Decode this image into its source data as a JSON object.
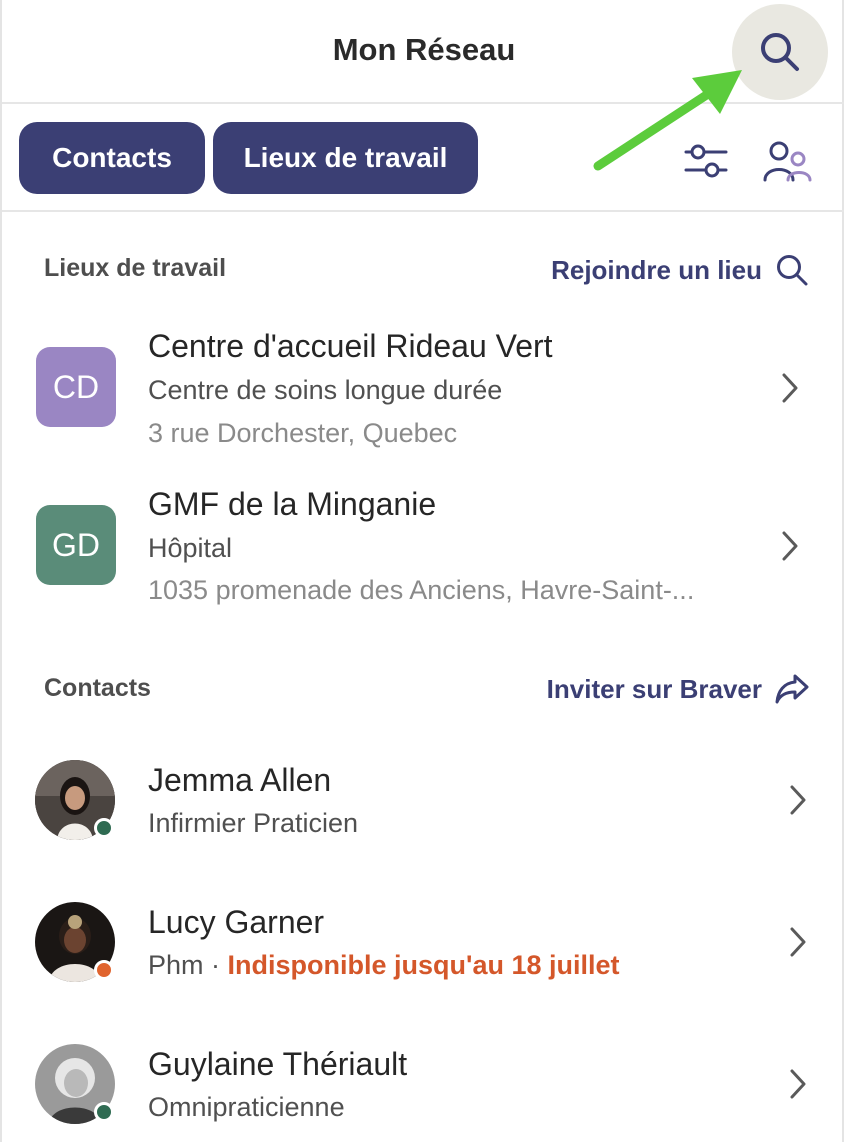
{
  "header": {
    "title": "Mon Réseau",
    "search_icon": "search-icon"
  },
  "tabs": [
    {
      "label": "Contacts"
    },
    {
      "label": "Lieux de travail"
    }
  ],
  "toolbar_icons": {
    "filter": "sliders-icon",
    "people": "people-icon"
  },
  "workplaces": {
    "title": "Lieux de travail",
    "action_label": "Rejoindre un lieu",
    "items": [
      {
        "initials": "CD",
        "color": "#9a86c3",
        "name": "Centre d'accueil Rideau Vert",
        "type": "Centre de soins longue durée",
        "address": "3 rue Dorchester, Quebec"
      },
      {
        "initials": "GD",
        "color": "#5a8c79",
        "name": "GMF de la Minganie",
        "type": "Hôpital",
        "address": "1035 promenade des Anciens, Havre-Saint-..."
      }
    ]
  },
  "contacts": {
    "title": "Contacts",
    "action_label": "Inviter sur Braver",
    "items": [
      {
        "name": "Jemma Allen",
        "role": "Infirmier Praticien",
        "status_color": "#2f6b52",
        "status_text": ""
      },
      {
        "name": "Lucy Garner",
        "role": "Phm",
        "separator": " · ",
        "status_color": "#e0642e",
        "status_text": "Indisponible jusqu'au 18 juillet"
      },
      {
        "name": "Guylaine Thériault",
        "role": "Omnipraticienne",
        "status_color": "#2f6b52",
        "status_text": ""
      }
    ]
  },
  "colors": {
    "accent": "#3b3f74",
    "annotation_arrow": "#5ccc3c",
    "unavailable": "#d4572a"
  }
}
